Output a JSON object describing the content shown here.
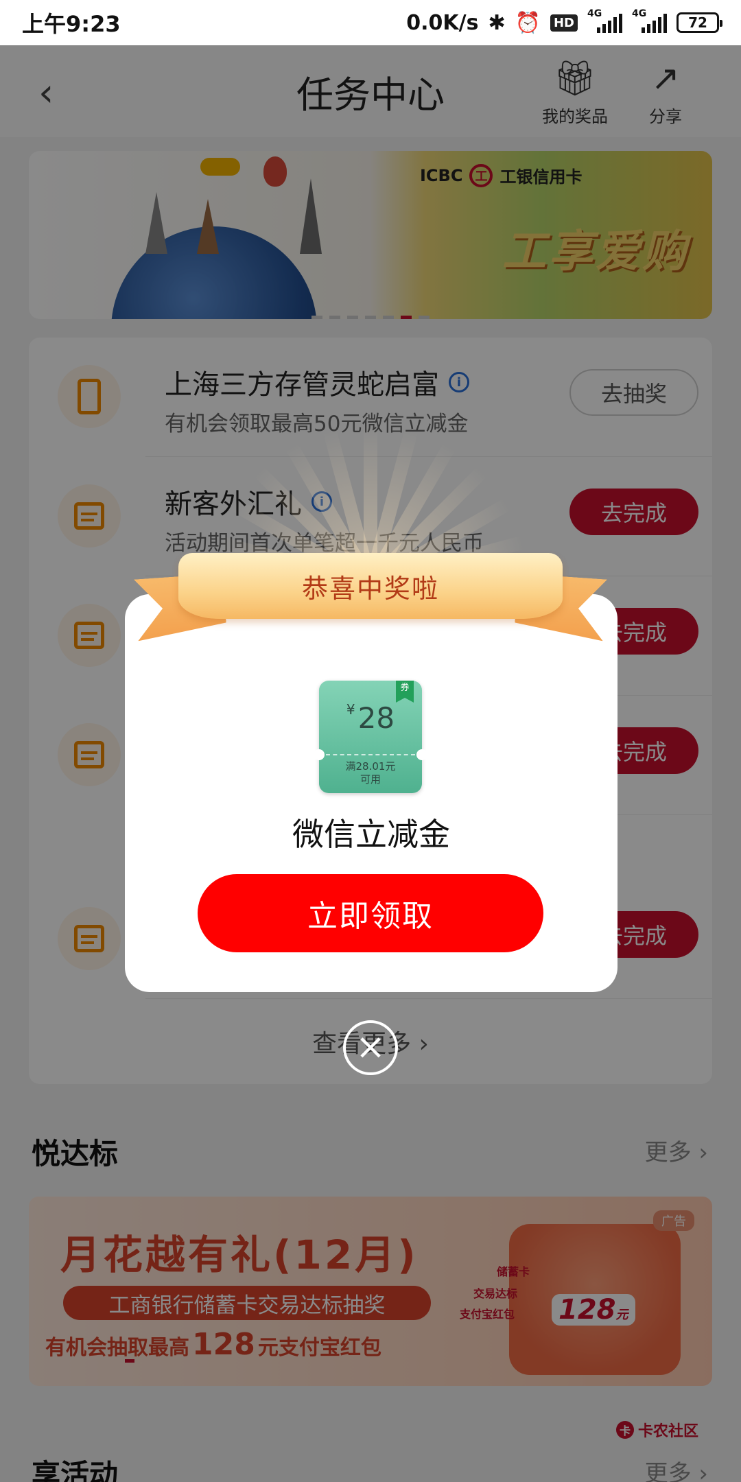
{
  "status_bar": {
    "time": "上午9:23",
    "net_speed": "0.0K/s",
    "bluetooth_icon": "bluetooth-icon",
    "alarm_icon": "alarm-icon",
    "hd_badge": "HD",
    "signal_1_label": "4G",
    "signal_2_label": "4G",
    "battery": "72"
  },
  "header": {
    "back_icon": "chevron-left-icon",
    "title": "任务中心",
    "prizes_label": "我的奖品",
    "prizes_icon": "gift-icon",
    "share_label": "分享",
    "share_icon": "share-icon"
  },
  "banner": {
    "brand": "ICBC",
    "bank_mark": "工",
    "card_label": "工银信用卡",
    "slogan": "工享爱购"
  },
  "tasks": [
    {
      "icon": "phone-check-icon",
      "title": "上海三方存管灵蛇启富",
      "subtitle": "有机会领取最高50元微信立减金",
      "button": "去抽奖"
    },
    {
      "icon": "calendar-icon",
      "title": "新客外汇礼",
      "subtitle": "活动期间首次单笔超一千元人民币",
      "button": "去完成"
    },
    {
      "icon": "calendar-icon",
      "title": "",
      "subtitle": "",
      "button": "去完成"
    },
    {
      "icon": "calendar-icon",
      "title": "",
      "subtitle": "",
      "button": "去完成"
    },
    {
      "icon": "calendar-icon",
      "title": "",
      "subtitle": "",
      "button": "去完成"
    }
  ],
  "view_more": "查看更多 ›",
  "section_yuedabiao": {
    "title": "悦达标",
    "more": "更多 ›"
  },
  "promo": {
    "title": "月花越有礼(12月)",
    "pill": "工商银行储蓄卡交易达标抽奖",
    "line_prefix": "有机会抽取最高",
    "line_amount": "128",
    "line_suffix": "元支付宝红包",
    "ad_badge": "广告",
    "tag_1": "储蓄卡",
    "tag_2": "交易达标",
    "tag_3": "支付宝红包",
    "amount": "128",
    "amount_unit": "元"
  },
  "section_xianghuodong": {
    "title": "享活动",
    "more": "更多 ›"
  },
  "watermark": {
    "mark": "卡",
    "text": "卡农社区"
  },
  "modal": {
    "ribbon": "恭喜中奖啦",
    "coupon": {
      "currency": "¥",
      "value": "28",
      "condition_1": "满28.01元",
      "condition_2": "可用",
      "bookmark": "券"
    },
    "prize_name": "微信立减金",
    "claim_button": "立即领取",
    "close_icon": "close-circle-icon"
  },
  "colors": {
    "brand_red": "#c8102e",
    "claim_red": "#ff0000",
    "task_icon_orange": "#f08a00",
    "coupon_green": "#4fb18f"
  }
}
